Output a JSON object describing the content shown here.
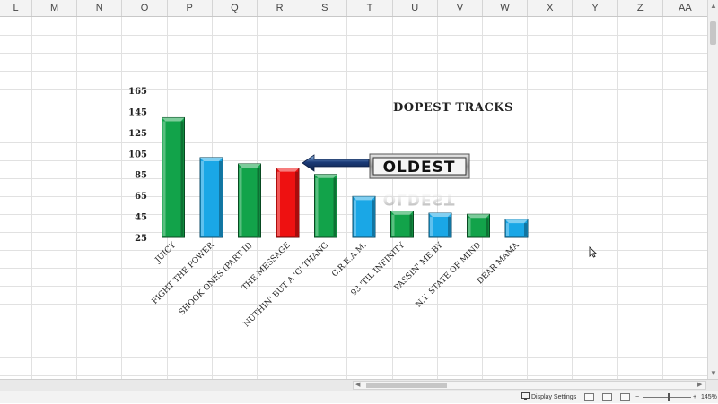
{
  "columns": [
    "L",
    "M",
    "N",
    "O",
    "P",
    "Q",
    "R",
    "S",
    "T",
    "U",
    "V",
    "W",
    "X",
    "Y",
    "Z",
    "AA"
  ],
  "chart_data": {
    "type": "bar",
    "title": "DOPEST TRACKS",
    "categories": [
      "JUICY",
      "FIGHT THE POWER",
      "SHOOK ONES (PART II)",
      "THE MESSAGE",
      "NUTHIN' BUT A 'G' THANG",
      "C.R.E.A.M.",
      "93 'TIL INFINITY",
      "PASSIN' ME BY",
      "N.Y. STATE OF MIND",
      "DEAR MAMA"
    ],
    "values": [
      139,
      101,
      95,
      91,
      85,
      64,
      50,
      48,
      47,
      42
    ],
    "colors": [
      "#12a34a",
      "#1aa7e6",
      "#12a34a",
      "#ee1111",
      "#12a34a",
      "#1aa7e6",
      "#12a34a",
      "#1aa7e6",
      "#12a34a",
      "#1aa7e6"
    ],
    "y_ticks": [
      25,
      45,
      65,
      85,
      105,
      125,
      145,
      165
    ],
    "ylim": [
      25,
      165
    ],
    "grid": false,
    "annotation": "OLDEST",
    "annotation_target": "THE MESSAGE"
  },
  "status_bar": {
    "display_settings": "Display Settings",
    "zoom_level": "145%",
    "zoom_minus": "−",
    "zoom_plus": "+"
  },
  "icons": {
    "display_settings": "monitor-icon",
    "view_normal": "grid-view-icon",
    "view_page_layout": "page-layout-icon",
    "view_page_break": "page-break-icon"
  }
}
